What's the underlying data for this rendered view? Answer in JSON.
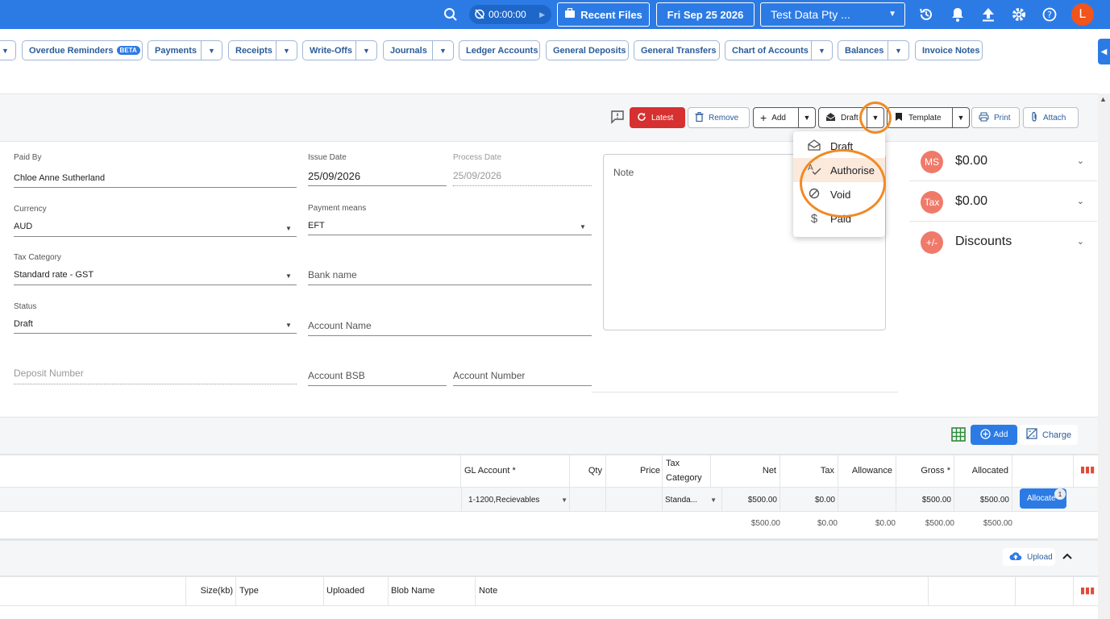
{
  "topbar": {
    "timer": "00:00:00",
    "recent_files": "Recent Files",
    "date": "Fri Sep 25 2026",
    "company": "Test Data Pty ...",
    "avatar": "L"
  },
  "nav": [
    {
      "label": "Overdue Reminders",
      "badge": "BETA"
    },
    {
      "label": "Payments"
    },
    {
      "label": "Receipts"
    },
    {
      "label": "Write-Offs"
    },
    {
      "label": "Journals"
    },
    {
      "label": "Ledger Accounts"
    },
    {
      "label": "General Deposits"
    },
    {
      "label": "General Transfers"
    },
    {
      "label": "Chart of Accounts"
    },
    {
      "label": "Balances"
    },
    {
      "label": "Invoice Notes"
    }
  ],
  "toolbar": {
    "latest": "Latest",
    "remove": "Remove",
    "add": "Add",
    "draft": "Draft",
    "template": "Template",
    "print": "Print",
    "attach": "Attach"
  },
  "status_menu": {
    "items": [
      "Draft",
      "Authorise",
      "Void",
      "Paid"
    ]
  },
  "form": {
    "paid_by_label": "Paid By",
    "paid_by": "Chloe Anne Sutherland",
    "issue_date_label": "Issue Date",
    "issue_date": "25/09/2026",
    "process_date_label": "Process Date",
    "process_date": "25/09/2026",
    "currency_label": "Currency",
    "currency": "AUD",
    "payment_means_label": "Payment means",
    "payment_means": "EFT",
    "tax_category_label": "Tax Category",
    "tax_category": "Standard rate - GST",
    "bank_name_placeholder": "Bank name",
    "status_label": "Status",
    "status": "Draft",
    "account_name_placeholder": "Account Name",
    "deposit_number_placeholder": "Deposit Number",
    "account_bsb_placeholder": "Account BSB",
    "account_number_placeholder": "Account Number",
    "note_placeholder": "Note"
  },
  "summary": [
    {
      "badge": "MS",
      "value": "$0.00"
    },
    {
      "badge": "Tax",
      "value": "$0.00"
    },
    {
      "badge": "+/-",
      "value": "Discounts"
    }
  ],
  "lines": {
    "add": "Add",
    "charge": "Charge",
    "headers": {
      "gl_account": "GL Account *",
      "qty": "Qty",
      "price": "Price",
      "tax_category": "Tax Category",
      "net": "Net",
      "tax": "Tax",
      "allowance": "Allowance",
      "gross": "Gross *",
      "allocated": "Allocated"
    },
    "row": {
      "gl_account": "1-1200,Recievables",
      "tax_category": "Standa...",
      "net": "$500.00",
      "tax": "$0.00",
      "gross": "$500.00",
      "allocated": "$500.00",
      "allocate_btn": "Allocate",
      "allocate_count": "1"
    },
    "totals": {
      "net": "$500.00",
      "tax": "$0.00",
      "allowance": "$0.00",
      "gross": "$500.00",
      "allocated": "$500.00"
    }
  },
  "attachments": {
    "upload": "Upload",
    "headers": {
      "size": "Size(kb)",
      "type": "Type",
      "uploaded": "Uploaded",
      "blob_name": "Blob Name",
      "note": "Note"
    }
  },
  "colors": {
    "primary": "#2c7be5",
    "danger": "#d63031",
    "highlight_ring": "#f08a24",
    "badge": "#f07a6a"
  }
}
